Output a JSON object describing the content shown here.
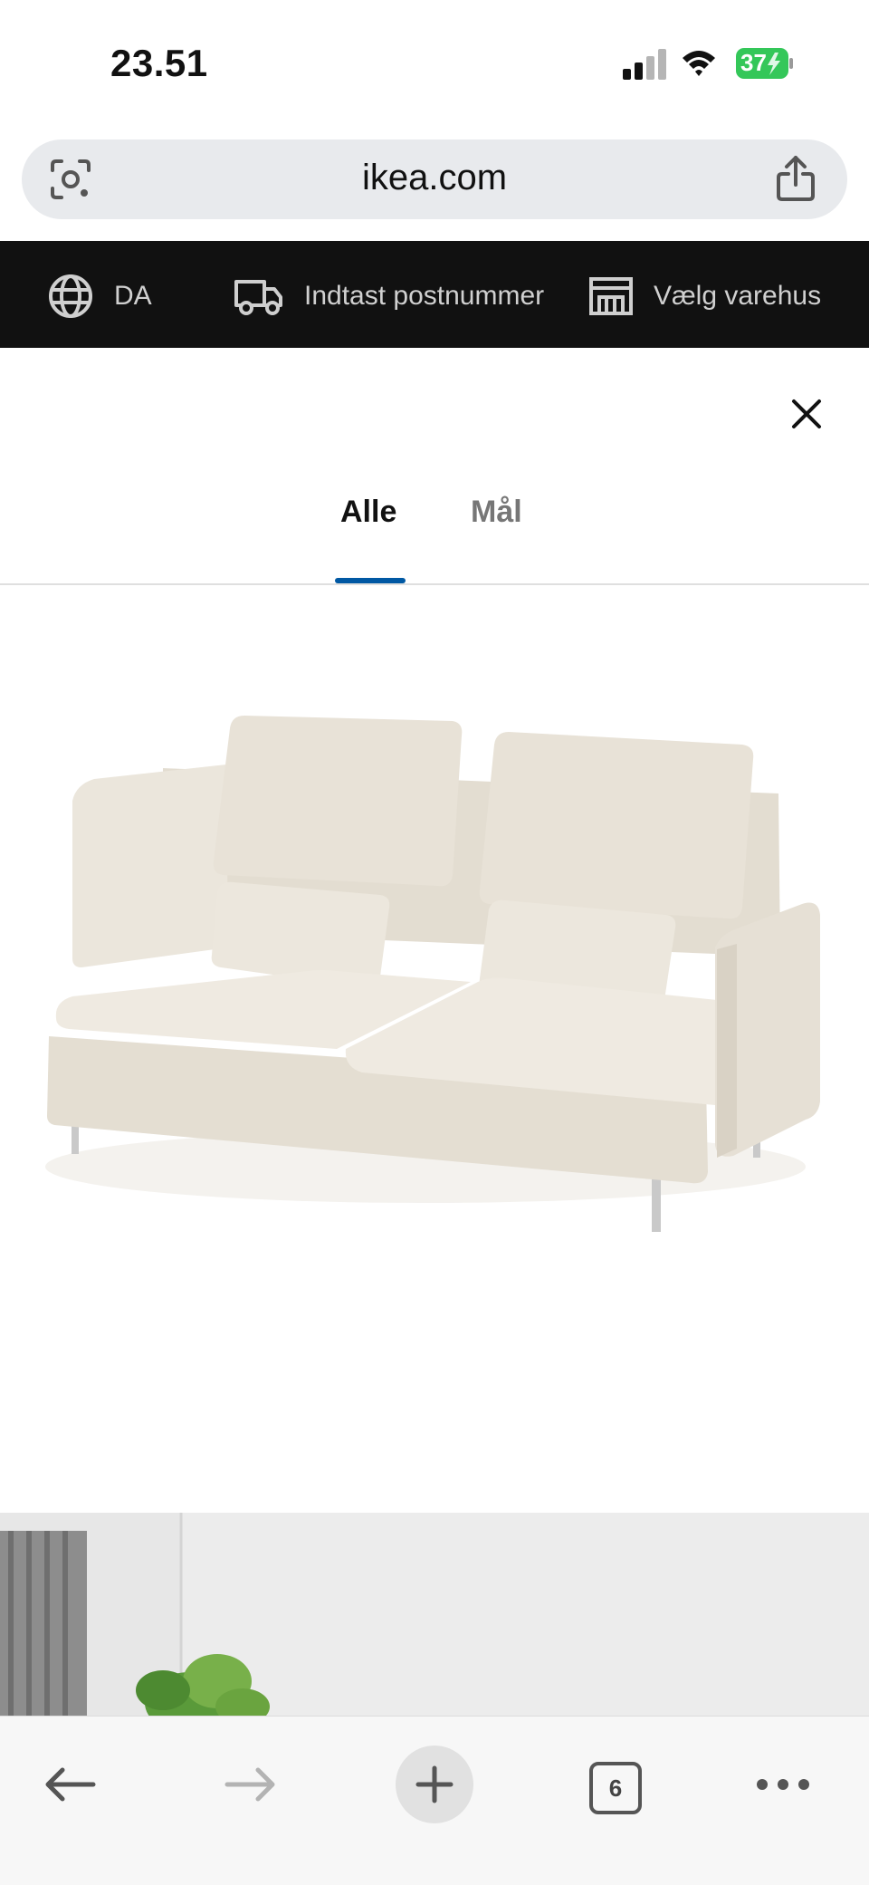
{
  "status_bar": {
    "time": "23.51",
    "battery": "37"
  },
  "browser": {
    "url": "ikea.com",
    "tab_count": "6"
  },
  "top_strip": {
    "language": "DA",
    "postcode_label": "Indtast postnummer",
    "store_label": "Vælg varehus"
  },
  "gallery": {
    "tabs": [
      {
        "label": "Alle",
        "selected": true
      },
      {
        "label": "Mål",
        "selected": false
      }
    ]
  },
  "colors": {
    "accent_blue": "#0058a3",
    "strip_background": "#111111",
    "sofa_fabric": "#e7e1d6",
    "battery_green": "#34c759"
  },
  "icons": {
    "lens": "camera-lens-icon",
    "share": "share-icon",
    "globe": "globe-icon",
    "truck": "delivery-truck-icon",
    "store": "store-icon",
    "close": "close-icon",
    "back": "back-arrow-icon",
    "forward": "forward-arrow-icon",
    "new_tab": "plus-icon",
    "more": "more-dots-icon"
  }
}
